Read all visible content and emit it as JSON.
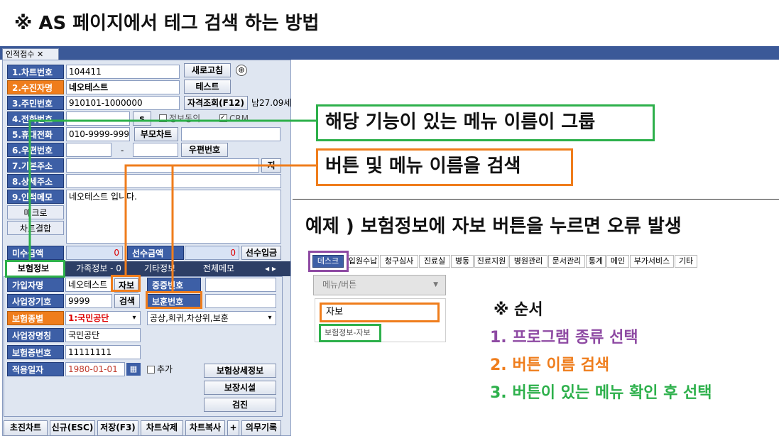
{
  "title": "※ AS 페이지에서 테그 검색 하는 방법",
  "window_tab": "인적접수",
  "fields": {
    "chart_no": {
      "label": "1.차트번호",
      "value": "104411"
    },
    "patient_name": {
      "label": "2.수진자명",
      "value": "네오테스트"
    },
    "resident_no": {
      "label": "3.주민번호",
      "value": "910101-1000000",
      "age": "남27.09세"
    },
    "phone": {
      "label": "4.전화번호",
      "consent": "정보동의",
      "crm": "CRM"
    },
    "mobile": {
      "label": "5.휴대전화",
      "value": "010-9999-9999"
    },
    "zip": {
      "label": "6.우편번호",
      "dash": "-"
    },
    "address": {
      "label": "7.기본주소"
    },
    "detail_address": {
      "label": "8.상세주소"
    },
    "memo": {
      "label": "9.인적메모",
      "value": "네오테스트 입니다."
    }
  },
  "buttons": {
    "refresh": "새로고침",
    "test": "테스트",
    "eligibility": "자격조회(F12)",
    "s": "s",
    "parent_chart": "부모차트",
    "zip_search": "우편번호",
    "macro": "매크로",
    "chart_merge": "차트결합",
    "advance_deposit": "선수입금",
    "jibun": "지"
  },
  "amounts": {
    "unpaid_label": "미수금액",
    "unpaid_value": "0",
    "advance_label": "선수금액",
    "advance_value": "0"
  },
  "subtabs": [
    "보험정보",
    "가족정보 - 0",
    "기타정보",
    "전체메모"
  ],
  "insurance": {
    "subscriber_label": "가입자명",
    "subscriber_value": "네오테스트",
    "jabo": "자보",
    "severe": "중증번호",
    "biz_no_label": "사업장기호",
    "biz_no_value": "9999",
    "search": "검색",
    "veteran": "보훈번호",
    "type_label": "보험종별",
    "type_value": "1:국민공단",
    "type_option": "공상,희귀,차상위,보훈",
    "biz_name_label": "사업장명칭",
    "biz_name_value": "국민공단",
    "cert_label": "보험증번호",
    "cert_value": "11111111",
    "apply_label": "적용일자",
    "apply_value": "1980-01-01",
    "add": "추가",
    "detail_btn": "보험상세정보",
    "facility_btn": "보장시설",
    "check_btn": "검진"
  },
  "bottom_buttons": [
    "초진차트",
    "신규(ESC)",
    "저장(F3)",
    "차트삭제",
    "차트복사",
    "+",
    "의무기록"
  ],
  "callouts": {
    "green": "해당 기능이 있는 메뉴 이름이 그룹",
    "orange": "버튼 및 메뉴 이름을 검색"
  },
  "example": "예제 ) 보험정보에 자보 버튼을 누르면 오류 발생",
  "menubar": [
    "데스크",
    "입원수납",
    "청구심사",
    "진료실",
    "병동",
    "진료지원",
    "병원관리",
    "문서관리",
    "통계",
    "메인",
    "부가서비스",
    "기타"
  ],
  "dropdown": {
    "placeholder": "메뉴/버튼",
    "search_value": "자보",
    "result": "보험정보-자보"
  },
  "steps": {
    "title": "※ 순서",
    "items": [
      "1. 프로그램 종류 선택",
      "2. 버튼 이름 검색",
      "3. 버튼이 있는 메뉴 확인 후 선택"
    ],
    "colors": [
      "#8e4aa3",
      "#ef7d1c",
      "#2db04b"
    ]
  }
}
